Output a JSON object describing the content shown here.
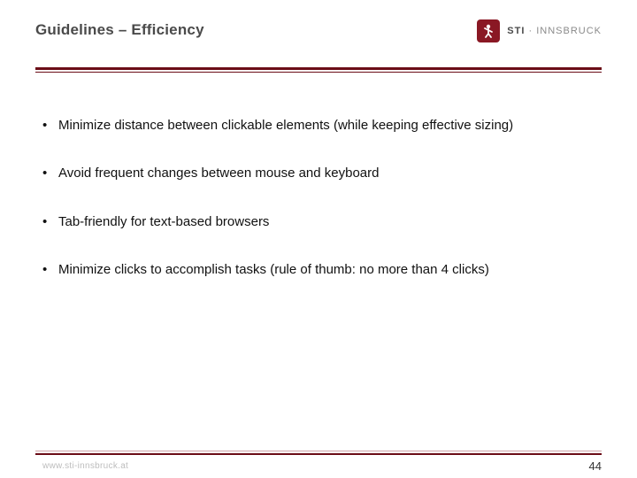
{
  "header": {
    "title": "Guidelines – Efficiency"
  },
  "logo": {
    "brand_bold": "STI",
    "brand_light": "INNSBRUCK",
    "icon_name": "sti-person-icon"
  },
  "bullets": [
    "Minimize distance between clickable elements (while keeping effective sizing)",
    "Avoid frequent changes between mouse and keyboard",
    "Tab-friendly for text-based browsers",
    "Minimize clicks to accomplish tasks (rule of thumb: no more than 4 clicks)"
  ],
  "footer": {
    "site": "www.sti-innsbruck.at",
    "page_number": "44"
  }
}
